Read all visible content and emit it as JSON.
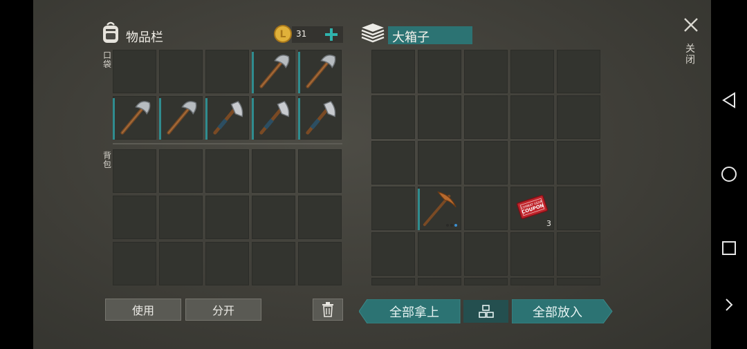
{
  "inventory": {
    "title": "物品栏",
    "coins": "31",
    "pocket_label": "口袋",
    "backpack_label": "背包",
    "pocket": [
      {
        "item": null
      },
      {
        "item": null
      },
      {
        "item": null
      },
      {
        "item": "stone-hatchet-icon",
        "durability": 0.95
      },
      {
        "item": "stone-hatchet-icon",
        "durability": 0.95
      },
      {
        "item": "stone-hatchet-icon",
        "durability": 0.95
      },
      {
        "item": "stone-hatchet-icon",
        "durability": 0.95
      },
      {
        "item": "iron-axe-icon",
        "durability": 0.95
      },
      {
        "item": "iron-axe-icon",
        "durability": 0.95
      },
      {
        "item": "iron-axe-icon",
        "durability": 0.95
      }
    ],
    "backpack_slots": 15,
    "use_label": "使用",
    "split_label": "分开"
  },
  "container": {
    "title": "大箱子",
    "close_label": "关闭",
    "take_all_label": "全部拿上",
    "put_all_label": "全部放入",
    "items": [
      {
        "slot": 16,
        "item": "pickaxe-icon",
        "durability": 0.95,
        "dots": 3
      },
      {
        "slot": 18,
        "item": "coupon-icon",
        "count": "3",
        "coupon_line1": "COMBAT GEAR",
        "coupon_line2": "COUPON"
      }
    ]
  },
  "colors": {
    "accent": "#2c7373",
    "coin": "#d9a92a",
    "coupon": "#c0242b"
  }
}
